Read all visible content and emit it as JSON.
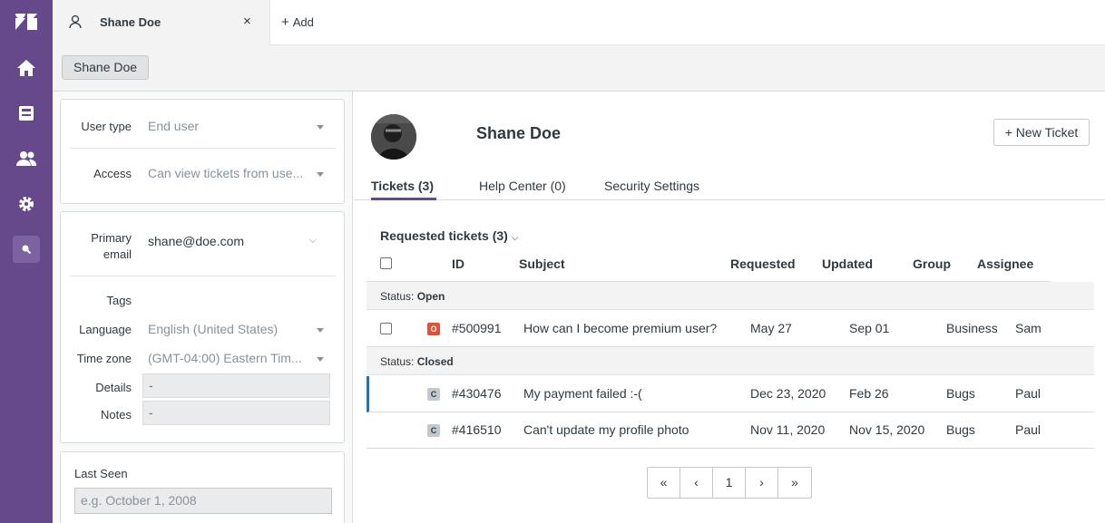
{
  "top_tab": {
    "user_name": "Shane Doe",
    "close": "×",
    "add_label": "Add",
    "add_plus": "+"
  },
  "breadcrumb": "Shane Doe",
  "details": {
    "user_type_label": "User type",
    "user_type_value": "End user",
    "access_label": "Access",
    "access_value": "Can view tickets from use...",
    "primary_email_label_1": "Primary",
    "primary_email_label_2": "email",
    "primary_email_value": "shane@doe.com",
    "tags_label": "Tags",
    "language_label": "Language",
    "language_value": "English (United States)",
    "timezone_label": "Time zone",
    "timezone_value": "(GMT-04:00) Eastern Tim...",
    "details_label": "Details",
    "details_value": "-",
    "notes_label": "Notes",
    "notes_value": "-",
    "last_seen_label": "Last Seen",
    "last_seen_placeholder": "e.g. October 1, 2008"
  },
  "profile": {
    "name": "Shane Doe",
    "new_ticket": "+ New Ticket",
    "tabs": [
      "Tickets (3)",
      "Help Center (0)",
      "Security Settings"
    ]
  },
  "tickets": {
    "section_title": "Requested tickets (3)",
    "columns": [
      "ID",
      "Subject",
      "Requested",
      "Updated",
      "Group",
      "Assignee"
    ],
    "status_prefix": "Status:",
    "groups": [
      {
        "status": "Open",
        "rows": [
          {
            "badge": "O",
            "id": "#500991",
            "subject": "How can I become premium user?",
            "requested": "May 27",
            "updated": "Sep 01",
            "group": "Business",
            "assignee": "Sam"
          }
        ]
      },
      {
        "status": "Closed",
        "rows": [
          {
            "badge": "C",
            "id": "#430476",
            "subject": "My payment failed :-(",
            "requested": "Dec 23, 2020",
            "updated": "Feb 26",
            "group": "Bugs",
            "assignee": "Paul"
          },
          {
            "badge": "C",
            "id": "#416510",
            "subject": "Can't update my profile photo",
            "requested": "Nov 11, 2020",
            "updated": "Nov 15, 2020",
            "group": "Bugs",
            "assignee": "Paul"
          }
        ]
      }
    ]
  },
  "pagination": [
    "«",
    "‹",
    "1",
    "›",
    "»"
  ],
  "colors": {
    "nav": "#66498b",
    "accent": "#1f73b7",
    "open_badge": "#e34f32"
  }
}
